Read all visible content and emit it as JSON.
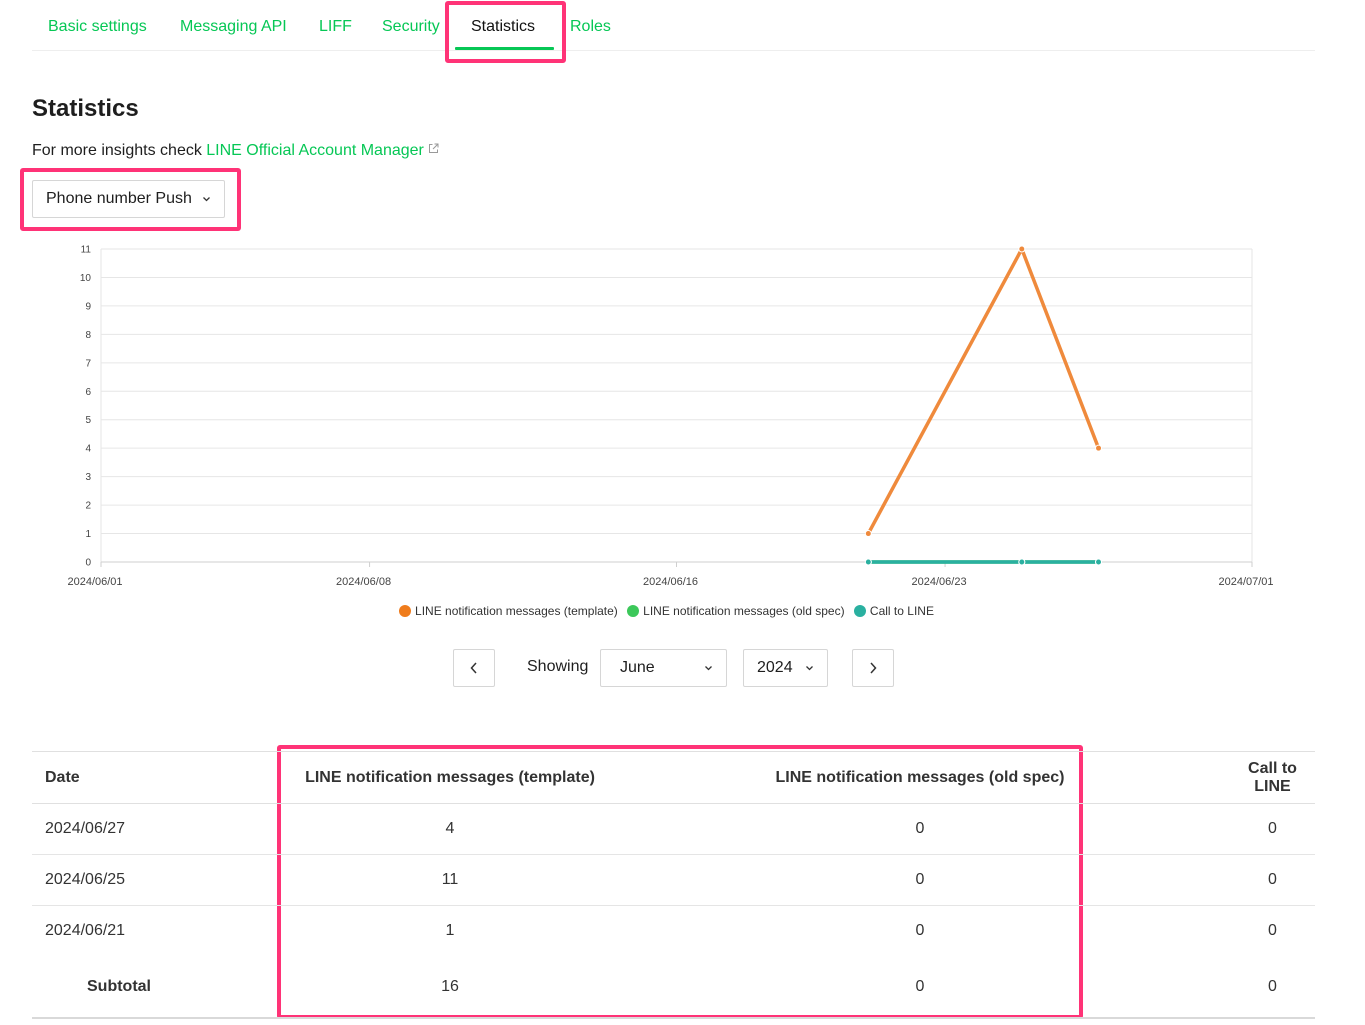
{
  "tabs": [
    {
      "label": "Basic settings",
      "active": false
    },
    {
      "label": "Messaging API",
      "active": false
    },
    {
      "label": "LIFF",
      "active": false
    },
    {
      "label": "Security",
      "active": false
    },
    {
      "label": "Statistics",
      "active": true
    },
    {
      "label": "Roles",
      "active": false
    }
  ],
  "page": {
    "title": "Statistics",
    "insights_prefix": "For more insights check ",
    "insights_link": "LINE Official Account Manager",
    "insights_link_icon": "external-link-icon"
  },
  "type_select": {
    "value": "Phone number Push"
  },
  "colors": {
    "accent": "#06c755",
    "highlight": "#ff3377",
    "series_template": "#ef8a3c",
    "series_old_spec": "#3cc85a",
    "series_call": "#2ab0a0"
  },
  "chart_data": {
    "type": "line",
    "x_ticks": [
      "2024/06/01",
      "2024/06/08",
      "2024/06/16",
      "2024/06/23",
      "2024/07/01"
    ],
    "ylim": [
      0,
      11
    ],
    "y_ticks": [
      0,
      1,
      2,
      3,
      4,
      5,
      6,
      7,
      8,
      9,
      10,
      11
    ],
    "grid": true,
    "legend_position": "bottom",
    "series": [
      {
        "name": "LINE notification messages (template)",
        "color": "#ef8a3c",
        "points": [
          {
            "x": "2024/06/21",
            "y": 1
          },
          {
            "x": "2024/06/25",
            "y": 11
          },
          {
            "x": "2024/06/27",
            "y": 4
          }
        ]
      },
      {
        "name": "LINE notification messages (old spec)",
        "color": "#3cc85a",
        "points": [
          {
            "x": "2024/06/21",
            "y": 0
          },
          {
            "x": "2024/06/25",
            "y": 0
          },
          {
            "x": "2024/06/27",
            "y": 0
          }
        ]
      },
      {
        "name": "Call to LINE",
        "color": "#2ab0a0",
        "points": [
          {
            "x": "2024/06/21",
            "y": 0
          },
          {
            "x": "2024/06/25",
            "y": 0
          },
          {
            "x": "2024/06/27",
            "y": 0
          }
        ]
      }
    ]
  },
  "period": {
    "showing_label": "Showing",
    "month": "June",
    "year": "2024",
    "prev_icon": "chevron-left-icon",
    "next_icon": "chevron-right-icon"
  },
  "table": {
    "headers": [
      "Date",
      "LINE notification messages (template)",
      "LINE notification messages (old spec)",
      "Call to LINE"
    ],
    "rows": [
      {
        "date": "2024/06/27",
        "template": "4",
        "old_spec": "0",
        "call": "0"
      },
      {
        "date": "2024/06/25",
        "template": "11",
        "old_spec": "0",
        "call": "0"
      },
      {
        "date": "2024/06/21",
        "template": "1",
        "old_spec": "0",
        "call": "0"
      }
    ],
    "subtotal": {
      "label": "Subtotal",
      "template": "16",
      "old_spec": "0",
      "call": "0"
    }
  }
}
